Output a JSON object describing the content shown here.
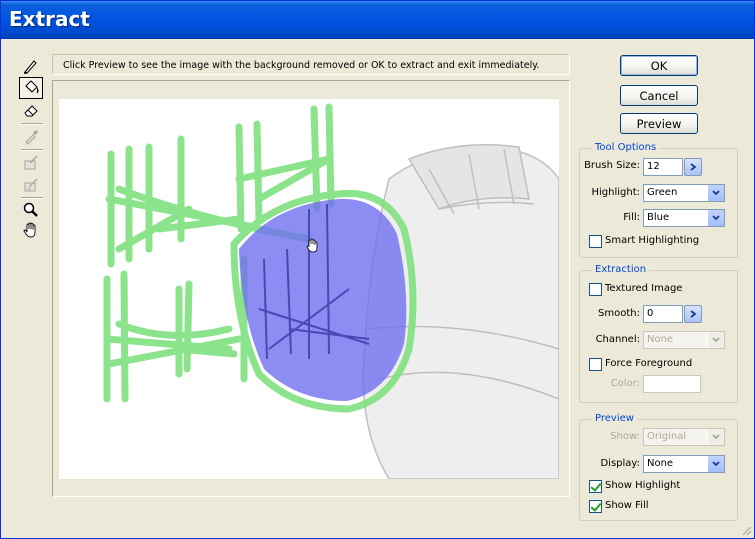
{
  "window": {
    "title": "Extract"
  },
  "hint": {
    "text": "Click Preview to see the image with the background removed or OK to extract and exit immediately."
  },
  "tools": [
    {
      "icon": "edge-highlighter-icon",
      "state": "normal"
    },
    {
      "icon": "fill-bucket-icon",
      "state": "selected"
    },
    {
      "icon": "eraser-icon",
      "state": "normal"
    },
    {
      "icon": "eyedropper-icon",
      "state": "disabled"
    },
    {
      "icon": "cleanup-tool-icon",
      "state": "disabled"
    },
    {
      "icon": "edge-touchup-icon",
      "state": "disabled"
    },
    {
      "icon": "zoom-icon",
      "state": "normal"
    },
    {
      "icon": "hand-icon",
      "state": "normal"
    }
  ],
  "buttons": {
    "ok": "OK",
    "cancel": "Cancel",
    "preview": "Preview"
  },
  "tool_options": {
    "legend": "Tool Options",
    "brush_size_label": "Brush Size:",
    "brush_size": "12",
    "highlight_label": "Highlight:",
    "highlight": "Green",
    "fill_label": "Fill:",
    "fill": "Blue",
    "smart_highlighting_label": "Smart Highlighting",
    "smart_highlighting": false
  },
  "extraction": {
    "legend": "Extraction",
    "textured_image_label": "Textured Image",
    "textured_image": false,
    "smooth_label": "Smooth:",
    "smooth": "0",
    "channel_label": "Channel:",
    "channel": "None",
    "force_foreground_label": "Force Foreground",
    "force_foreground": false,
    "color_label": "Color:"
  },
  "preview": {
    "legend": "Preview",
    "show_label": "Show:",
    "show": "Original",
    "display_label": "Display:",
    "display": "None",
    "show_highlight_label": "Show Highlight",
    "show_highlight": true,
    "show_fill_label": "Show Fill",
    "show_fill": true
  },
  "colors": {
    "highlight": "#7fe07f",
    "fill": "#6f6ff0",
    "title_bar": "#0054e3",
    "accent_text": "#0046d5"
  }
}
